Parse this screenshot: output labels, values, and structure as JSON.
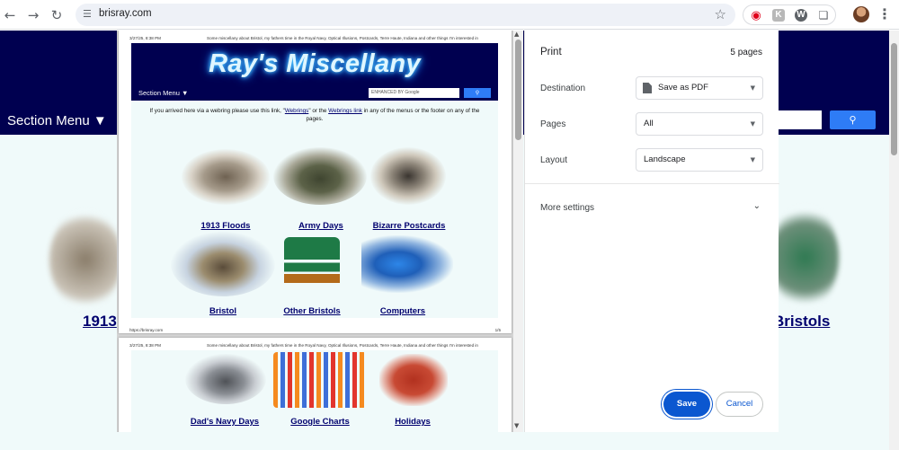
{
  "browser": {
    "url": "brisray.com",
    "back_icon": "arrow-left-icon",
    "forward_icon": "arrow-right-icon",
    "reload_icon": "reload-icon"
  },
  "page": {
    "section_menu": "Section Menu",
    "links": [
      "1913",
      "Bristols"
    ]
  },
  "preview": {
    "sheet_date": "3/27/25, 8:38 PM",
    "sheet_desc": "Some miscellany about Bristol, my fathers time in the Royal Navy, Optical Illusions, Postcards, Terre Haute, Indiana and other things I'm interested in",
    "footer_url": "https://brisray.com",
    "page_num": "1/5",
    "site_title": "Ray's Miscellany",
    "section_menu": "Section Menu",
    "search_placeholder": "ENHANCED BY Google",
    "notice_a": "If you arrived here via a webring please use this link, \"",
    "notice_link1": "Webrings",
    "notice_b": "\" or the ",
    "notice_link2": "Webrings link",
    "notice_c": " in any of the menus or the footer on any of the pages.",
    "items": [
      {
        "label": "1913 Floods"
      },
      {
        "label": "Army Days"
      },
      {
        "label": "Bizarre Postcards"
      },
      {
        "label": "Bristol"
      },
      {
        "label": "Other Bristols"
      },
      {
        "label": "Computers"
      }
    ],
    "items2": [
      {
        "label": "Dad's Navy Days"
      },
      {
        "label": "Google Charts"
      },
      {
        "label": "Holidays"
      }
    ]
  },
  "print": {
    "title": "Print",
    "page_count": "5 pages",
    "destination_label": "Destination",
    "destination_value": "Save as PDF",
    "pages_label": "Pages",
    "pages_value": "All",
    "layout_label": "Layout",
    "layout_value": "Landscape",
    "more_settings": "More settings",
    "save": "Save",
    "cancel": "Cancel"
  },
  "colors": {
    "site_header": "#000050",
    "accent_blue": "#0b57d0",
    "search_blue": "#2e7cf6",
    "link_navy": "#00006e"
  }
}
